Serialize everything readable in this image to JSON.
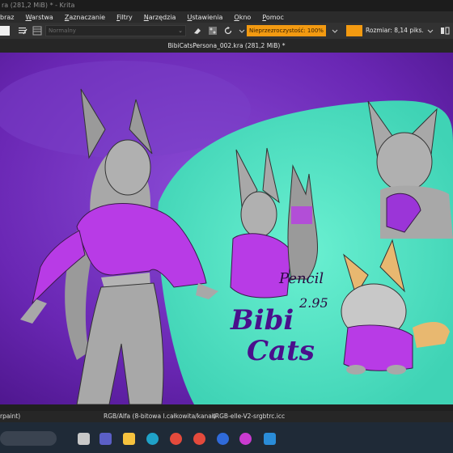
{
  "window": {
    "title": "ra (281,2 MiB) * - Krita"
  },
  "menu": [
    {
      "pre": "",
      "u": "",
      "post": "braz"
    },
    {
      "pre": "",
      "u": "W",
      "post": "arstwa"
    },
    {
      "pre": "",
      "u": "Z",
      "post": "aznaczanie"
    },
    {
      "pre": "",
      "u": "F",
      "post": "iltry"
    },
    {
      "pre": "",
      "u": "N",
      "post": "arzędzia"
    },
    {
      "pre": "",
      "u": "U",
      "post": "stawienia"
    },
    {
      "pre": "",
      "u": "O",
      "post": "kno"
    },
    {
      "pre": "",
      "u": "P",
      "post": "omoc"
    }
  ],
  "toolbar": {
    "blend_mode": "Normalny",
    "opacity_label": "Nieprzezroczystość: 100%",
    "size_label": "Rozmiar: 8,14 piks.",
    "accent": "#f39a11"
  },
  "document": {
    "tab_title": "BibiCatsPersona_002.kra (281,2 MiB) *"
  },
  "artwork": {
    "sign1": "Pencil",
    "sign2": "2.95",
    "logo_top": "Bibi",
    "logo_bottom": "Cats"
  },
  "status": {
    "tool": "rpaint)",
    "color_space": "RGB/Alfa (8-bitowa l.całkowita/kanał)",
    "profile": "sRGB-elle-V2-srgbtrc.icc"
  },
  "taskbar": {
    "bg": "#1f2a37",
    "icons": [
      "task-view-icon",
      "teams-icon",
      "file-explorer-icon",
      "edge-icon",
      "chrome-icon",
      "bluetooth-icon",
      "paint-icon",
      "krita-icon"
    ]
  }
}
